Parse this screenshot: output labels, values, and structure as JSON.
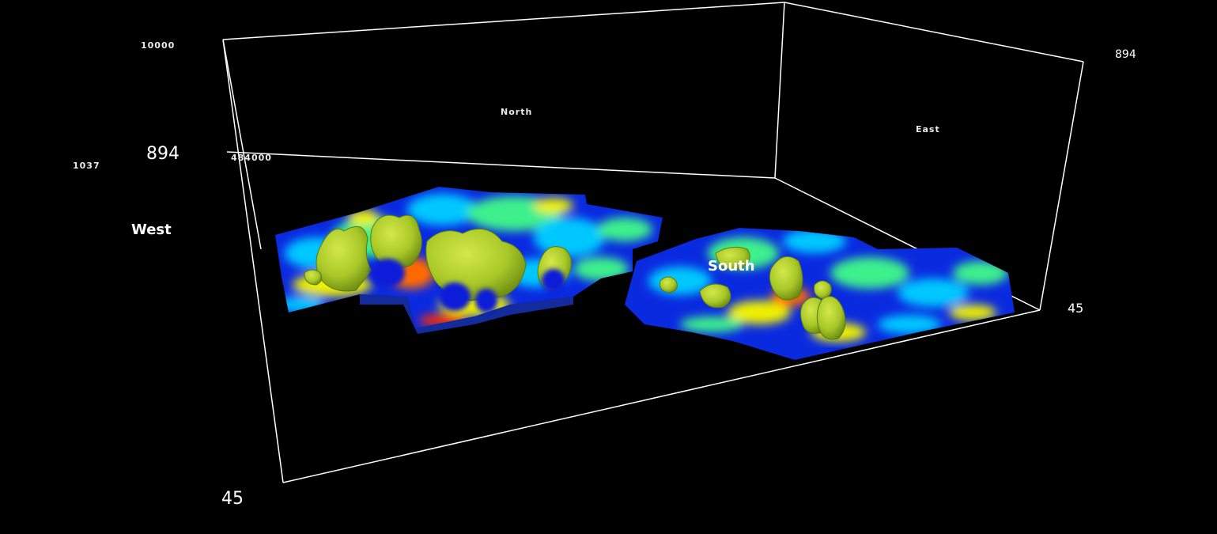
{
  "viewer": {
    "background": "#000000",
    "frame_color": "#ffffff",
    "axis_labels": {
      "depth_left_value": "894",
      "depth_top_left_value": "1037",
      "depth_right_value": "894",
      "bottom_left_value": "45",
      "bottom_right_value": "45",
      "west_label": "West",
      "south_label": "South",
      "north_label": "North",
      "east_label": "East",
      "top_left_tick": "10000",
      "front_left_tick": "484000"
    },
    "colormap": {
      "low": "#0a1ad8",
      "mid_low": "#00c8ff",
      "mid": "#3cf08c",
      "mid_high": "#f0f000",
      "high": "#ff2a00"
    },
    "isosurface_color": "#a8c828"
  }
}
